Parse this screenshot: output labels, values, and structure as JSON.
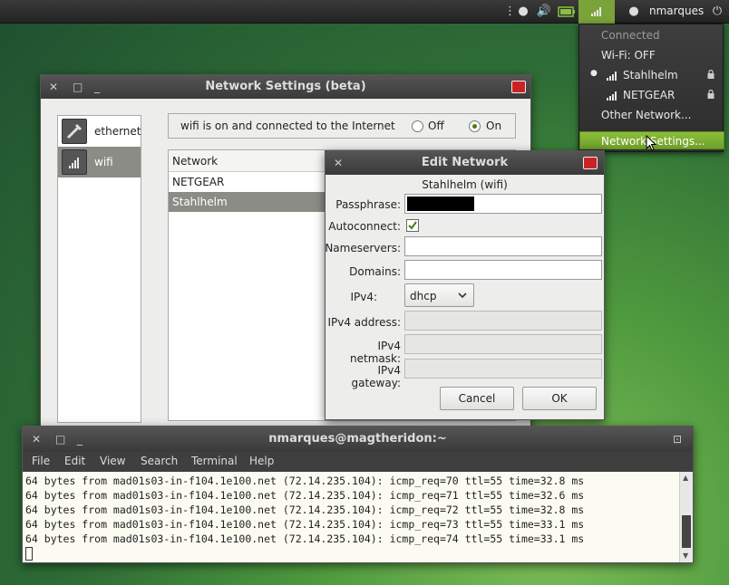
{
  "panel": {
    "username": "nmarques",
    "icons": [
      "keyboard-icon",
      "chat-icon",
      "volume-icon",
      "battery-icon",
      "signal-icon",
      "user-icon",
      "power-icon"
    ]
  },
  "netmenu": {
    "status": "Connected",
    "wifi_state": "Wi-Fi: OFF",
    "networks": [
      "Stahlhelm",
      "NETGEAR"
    ],
    "other": "Other Network...",
    "settings": "Network Settings..."
  },
  "network_settings": {
    "title": "Network Settings (beta)",
    "sidebar": [
      "ethernet",
      "wifi"
    ],
    "status_text": "wifi is on and connected to the Internet",
    "off_label": "Off",
    "on_label": "On",
    "table_header": "Network",
    "rows": [
      "NETGEAR",
      "Stahlhelm"
    ]
  },
  "edit_network": {
    "title": "Edit Network",
    "subtitle": "Stahlhelm (wifi)",
    "passphrase_label": "Passphrase:",
    "autoconnect_label": "Autoconnect:",
    "nameservers_label": "Nameservers:",
    "domains_label": "Domains:",
    "ipv4_label": "IPv4:",
    "ipv4_value": "dhcp",
    "ipv4_address_label": "IPv4 address:",
    "ipv4_netmask_label": "IPv4 netmask:",
    "ipv4_gateway_label": "IPv4 gateway:",
    "cancel": "Cancel",
    "ok": "OK"
  },
  "terminal": {
    "title": "nmarques@magtheridon:~",
    "menu": [
      "File",
      "Edit",
      "View",
      "Search",
      "Terminal",
      "Help"
    ],
    "lines": [
      "64 bytes from mad01s03-in-f104.1e100.net (72.14.235.104): icmp_req=70 ttl=55 time=32.8 ms",
      "64 bytes from mad01s03-in-f104.1e100.net (72.14.235.104): icmp_req=71 ttl=55 time=32.6 ms",
      "64 bytes from mad01s03-in-f104.1e100.net (72.14.235.104): icmp_req=72 ttl=55 time=32.8 ms",
      "64 bytes from mad01s03-in-f104.1e100.net (72.14.235.104): icmp_req=73 ttl=55 time=33.1 ms",
      "64 bytes from mad01s03-in-f104.1e100.net (72.14.235.104): icmp_req=74 ttl=55 time=33.1 ms"
    ]
  },
  "colors": {
    "accent": "#7aa33a",
    "selection": "#8c8c86"
  }
}
